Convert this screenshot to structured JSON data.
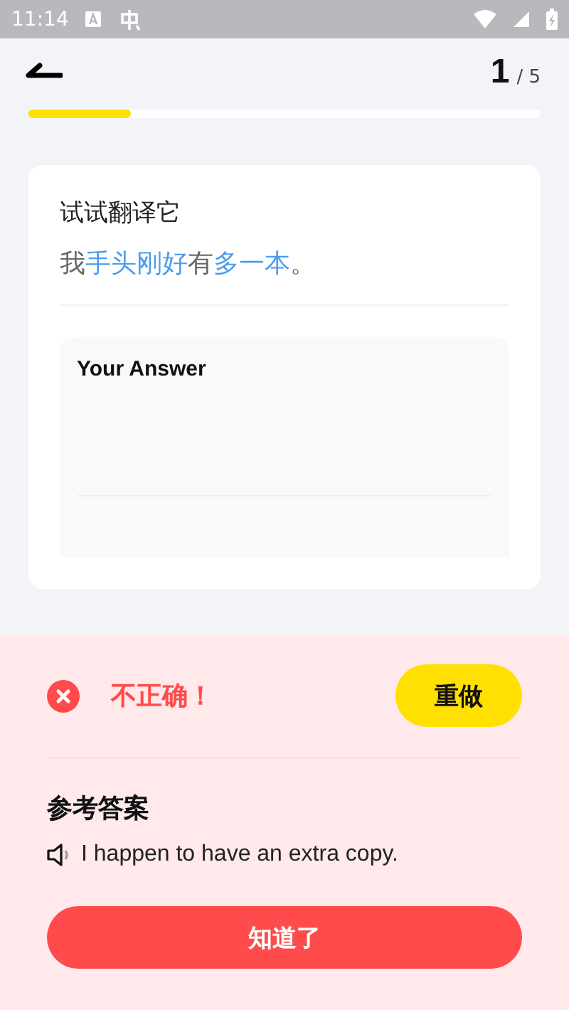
{
  "status_bar": {
    "time": "11:14"
  },
  "header": {
    "current": "1",
    "total": "/ 5"
  },
  "progress": {
    "level": 0.2
  },
  "card": {
    "title": "试试翻译它",
    "sentence": [
      {
        "text": "我",
        "highlighted": false
      },
      {
        "text": "手头刚好",
        "highlighted": true
      },
      {
        "text": "有",
        "highlighted": false
      },
      {
        "text": "多一本",
        "highlighted": true
      },
      {
        "text": "。",
        "highlighted": false
      }
    ],
    "answer": {
      "label": "Your Answer"
    }
  },
  "result": {
    "correct": false,
    "message": "不正确！",
    "retry_button": "重做",
    "reference_title": "参考答案",
    "reference_text": "I happen to have an extra copy.",
    "confirm_button": "知道了"
  }
}
